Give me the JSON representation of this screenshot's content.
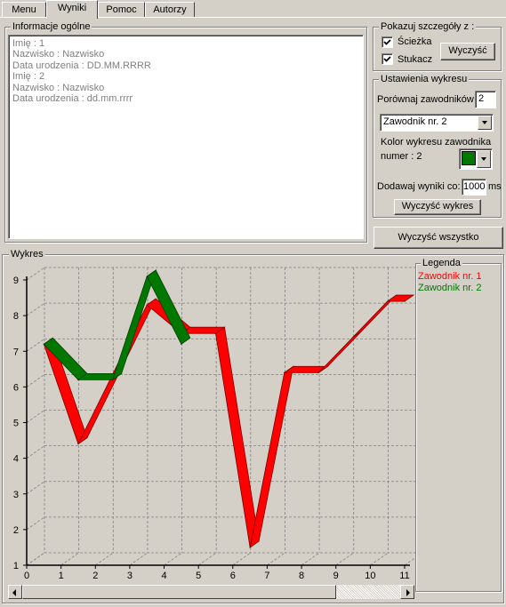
{
  "tabs": [
    {
      "label": "Menu",
      "active": false
    },
    {
      "label": "Wyniki",
      "active": true
    },
    {
      "label": "Pomoc",
      "active": false
    },
    {
      "label": "Autorzy",
      "active": false
    }
  ],
  "info_panel": {
    "title": "Informacje ogólne",
    "lines": [
      "Imię : 1",
      "Nazwisko : Nazwisko",
      "Data urodzenia : DD.MM.RRRR",
      "Imię : 2",
      "Nazwisko : Nazwisko",
      "Data urodzenia : dd.mm.rrrr"
    ]
  },
  "details_panel": {
    "title": "Pokazuj szczegóły z :",
    "path_checkbox": {
      "label": "Ścieżka",
      "checked": true
    },
    "knocker_checkbox": {
      "label": "Stukacz",
      "checked": true
    },
    "clear_button": "Wyczyść"
  },
  "chart_settings": {
    "title": "Ustawienia wykresu",
    "compare_label": "Porównaj zawodników",
    "compare_value": "2",
    "player_select": "Zawodnik nr. 2",
    "color_label_1": "Kolor wykresu zawodnika",
    "color_label_2": "numer : 2",
    "color_value": "#007800",
    "add_results_label": "Dodawaj wyniki co:",
    "add_results_value": "1000",
    "add_results_unit": "ms",
    "clear_chart_button": "Wyczyść wykres"
  },
  "clear_all_button": "Wyczyść wszystko",
  "chart_panel": {
    "title": "Wykres"
  },
  "legend": {
    "title": "Legenda",
    "items": [
      {
        "label": "Zawodnik nr. 1",
        "color": "#ff0000"
      },
      {
        "label": "Zawodnik nr. 2",
        "color": "#007800"
      }
    ]
  },
  "chart_data": {
    "type": "line",
    "style": "3d-ribbon",
    "x_ticks": [
      "0",
      "1",
      "2",
      "3",
      "4",
      "5",
      "6",
      "7",
      "8",
      "9",
      "10",
      "11"
    ],
    "y_ticks": [
      "1",
      "2",
      "3",
      "4",
      "5",
      "6",
      "7",
      "8",
      "9"
    ],
    "xlim": [
      0,
      11
    ],
    "ylim": [
      1,
      9
    ],
    "grid": true,
    "series": [
      {
        "name": "Zawodnik nr. 1",
        "color": "#ff0000",
        "x": [
          0.5,
          1.5,
          3.5,
          4.5,
          5.5,
          6.5,
          7.5,
          8.5,
          9.5,
          10.5,
          11
        ],
        "y": [
          7.2,
          4.4,
          8.3,
          7.5,
          7.5,
          1.5,
          6.4,
          6.4,
          7.4,
          8.4,
          8.4
        ]
      },
      {
        "name": "Zawodnik nr. 2",
        "color": "#007800",
        "x": [
          0.5,
          1.5,
          2.5,
          3.5,
          4.5
        ],
        "y": [
          7.2,
          6.2,
          6.2,
          9.1,
          7.2
        ]
      }
    ]
  }
}
